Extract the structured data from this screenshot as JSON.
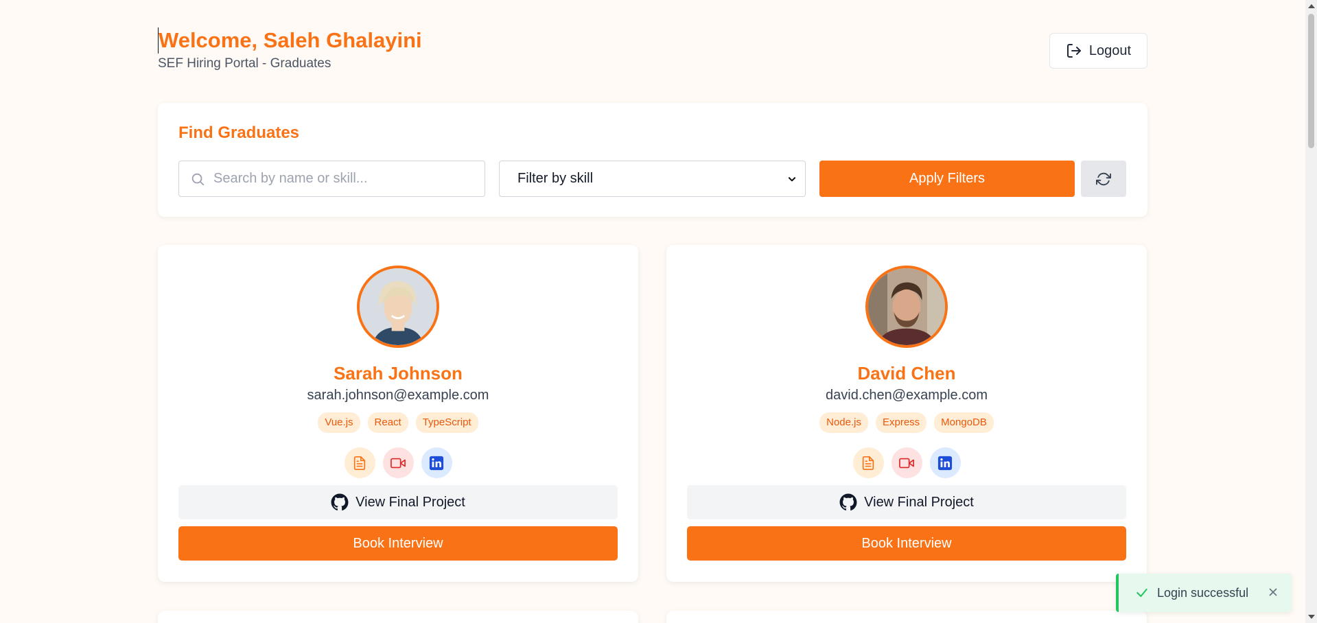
{
  "header": {
    "welcome": "Welcome, Saleh Ghalayini",
    "subtitle": "SEF Hiring Portal - Graduates",
    "logout_label": "Logout"
  },
  "filters": {
    "title": "Find Graduates",
    "search_placeholder": "Search by name or skill...",
    "skill_select_value": "Filter by skill",
    "apply_label": "Apply Filters"
  },
  "graduates": [
    {
      "name": "Sarah Johnson",
      "email": "sarah.johnson@example.com",
      "skills": [
        "Vue.js",
        "React",
        "TypeScript"
      ],
      "project_label": "View Final Project",
      "book_label": "Book Interview"
    },
    {
      "name": "David Chen",
      "email": "david.chen@example.com",
      "skills": [
        "Node.js",
        "Express",
        "MongoDB"
      ],
      "project_label": "View Final Project",
      "book_label": "Book Interview"
    }
  ],
  "toast": {
    "message": "Login successful"
  },
  "colors": {
    "accent": "#f97316",
    "background": "#fffaf5",
    "success": "#22c55e"
  }
}
